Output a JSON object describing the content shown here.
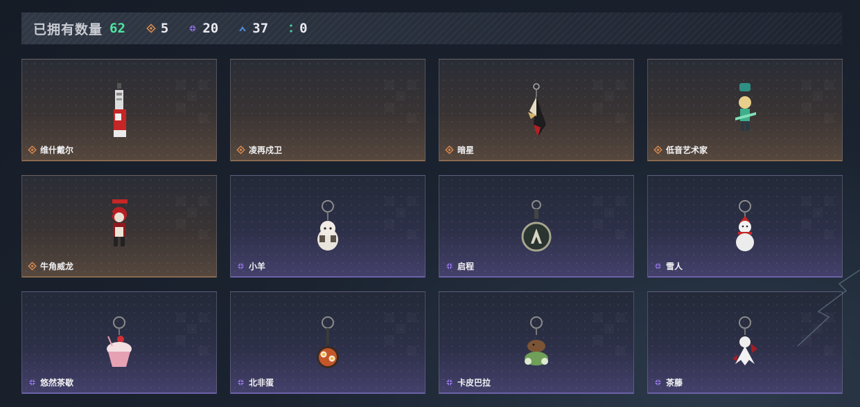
{
  "header": {
    "title": "已拥有数量",
    "total": "62",
    "stats": [
      {
        "icon": "orange-diamond-rank-icon",
        "color": "#d98a4f",
        "value": "5"
      },
      {
        "icon": "purple-diamond-rank-icon",
        "color": "#8f73e0",
        "value": "20"
      },
      {
        "icon": "blue-chevron-rank-icon",
        "color": "#4f8ed8",
        "value": "37"
      },
      {
        "icon": "green-dots-rank-icon",
        "color": "#3fcf98",
        "value": "0"
      }
    ]
  },
  "items": [
    {
      "name": "维什戴尔",
      "rarity": "orange",
      "icon": "red-white-card-pendant-icon"
    },
    {
      "name": "凌再戍卫",
      "rarity": "orange",
      "icon": "empty-slot-icon"
    },
    {
      "name": "暗星",
      "rarity": "orange",
      "icon": "dark-star-pendant-icon"
    },
    {
      "name": "低音艺术家",
      "rarity": "orange",
      "icon": "bass-artist-figure-icon"
    },
    {
      "name": "牛角威龙",
      "rarity": "orange",
      "icon": "horned-dragon-figure-icon"
    },
    {
      "name": "小羊",
      "rarity": "purple",
      "icon": "lamb-keychain-icon"
    },
    {
      "name": "启程",
      "rarity": "purple",
      "icon": "ring-medallion-keychain-icon"
    },
    {
      "name": "雪人",
      "rarity": "purple",
      "icon": "snowman-keychain-icon"
    },
    {
      "name": "悠然茶歇",
      "rarity": "purple",
      "icon": "cupcake-keychain-icon"
    },
    {
      "name": "北非蛋",
      "rarity": "purple",
      "icon": "shakshuka-pan-keychain-icon"
    },
    {
      "name": "卡皮巴拉",
      "rarity": "purple",
      "icon": "capybara-keychain-icon"
    },
    {
      "name": "茶藤",
      "rarity": "purple",
      "icon": "white-figure-keychain-icon"
    }
  ],
  "colors": {
    "accent_green": "#4ee6a0",
    "orange_rank": "#d98a4f",
    "purple_rank": "#8f73e0"
  }
}
